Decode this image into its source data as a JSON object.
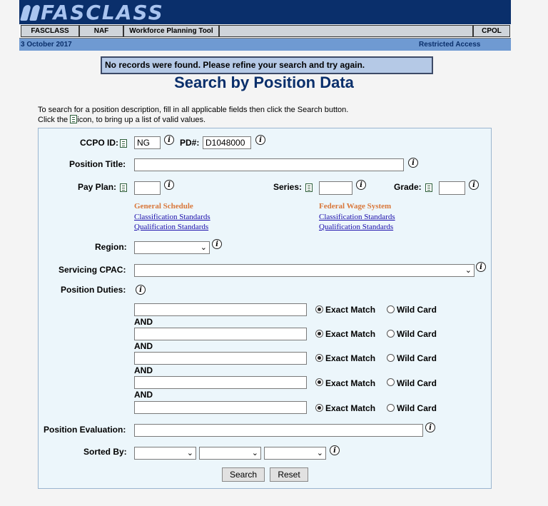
{
  "header": {
    "logo_text": "FASCLASS",
    "nav": [
      "FASCLASS",
      "NAF",
      "Workforce Planning Tool"
    ],
    "nav_right": "CPOL",
    "date": "3 October 2017",
    "access": "Restricted Access"
  },
  "alert": "No records were found. Please refine your search and try again.",
  "page_title": "Search by Position Data",
  "instructions": {
    "line1": "To search for a position description, fill in all applicable fields then click the Search button.",
    "line2_pre": "Click the",
    "line2_post": "icon, to bring up a list of valid values."
  },
  "form": {
    "ccpo_label": "CCPO ID:",
    "ccpo_value": "NG",
    "pd_label": "PD#:",
    "pd_value": "D1048000",
    "position_title_label": "Position Title:",
    "pay_plan_label": "Pay Plan:",
    "series_label": "Series:",
    "grade_label": "Grade:",
    "gs_head": "General Schedule",
    "gs_links": [
      "Classification Standards",
      "Qualification Standards"
    ],
    "fws_head": "Federal Wage System",
    "fws_links": [
      "Classification Standards",
      "Qualification Standards"
    ],
    "region_label": "Region:",
    "cpac_label": "Servicing CPAC:",
    "duties_label": "Position Duties:",
    "and_label": "AND",
    "exact_label": "Exact Match",
    "wild_label": "Wild Card",
    "duty_rows": 5,
    "evaluation_label": "Position Evaluation:",
    "sorted_label": "Sorted By:",
    "search_button": "Search",
    "reset_button": "Reset"
  },
  "colors": {
    "header_dark": "#0a2f6b",
    "info_bar": "#6f9ad2",
    "panel_bg": "#ecf6fb",
    "schedule_head": "#d9773a"
  }
}
